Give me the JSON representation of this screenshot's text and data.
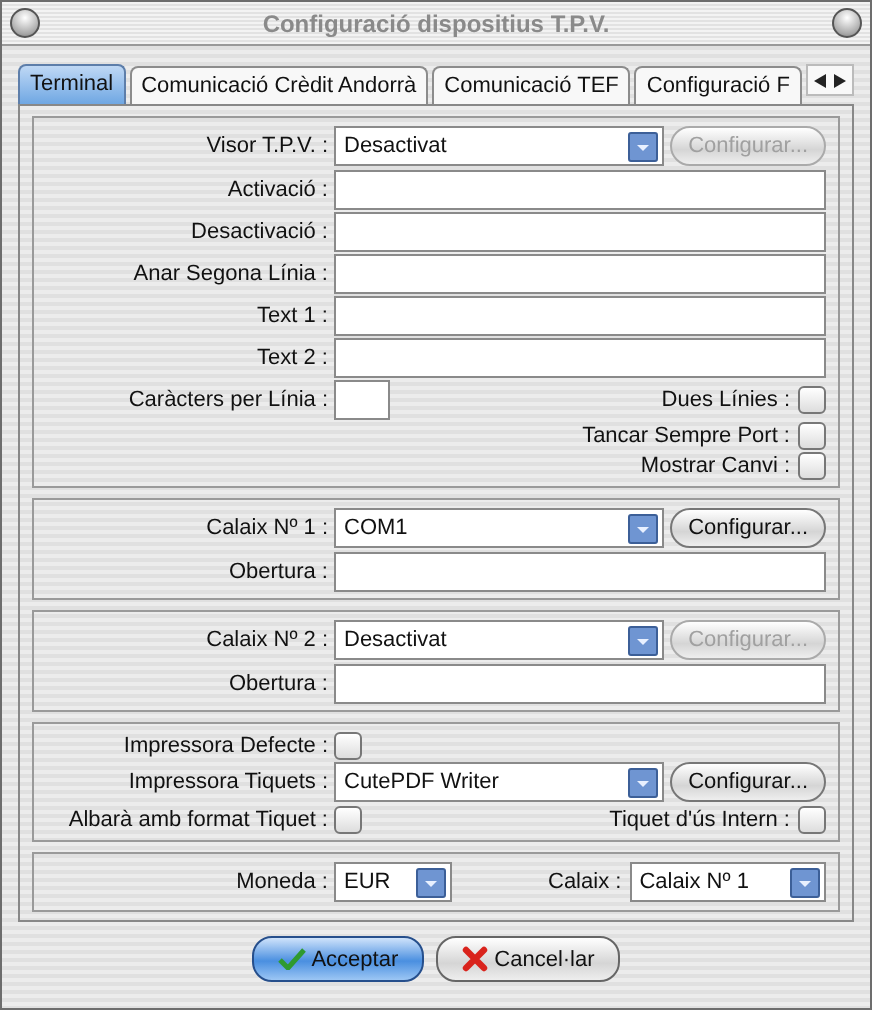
{
  "window": {
    "title": "Configuració dispositius T.P.V."
  },
  "tabs": [
    {
      "label": "Terminal",
      "selected": true
    },
    {
      "label": "Comunicació Crèdit Andorrà",
      "selected": false
    },
    {
      "label": "Comunicació TEF",
      "selected": false
    },
    {
      "label": "Configuració F",
      "selected": false
    }
  ],
  "sections": [
    {
      "rows": [
        {
          "kind": "combo",
          "label": "Visor T.P.V. :",
          "value": "Desactivat",
          "button": {
            "label": "Configurar...",
            "disabled": true
          }
        },
        {
          "kind": "text",
          "label": "Activació :"
        },
        {
          "kind": "text",
          "label": "Desactivació :"
        },
        {
          "kind": "text",
          "label": "Anar Segona Línia :"
        },
        {
          "kind": "text",
          "label": "Text 1 :"
        },
        {
          "kind": "text",
          "label": "Text 2 :"
        },
        {
          "kind": "short",
          "label": "Caràcters per Línia :",
          "right_label": "Dues Línies :",
          "right_checked": false
        },
        {
          "kind": "check_right",
          "right_label": "Tancar Sempre Port :",
          "right_checked": false
        },
        {
          "kind": "check_right",
          "right_label": "Mostrar Canvi :",
          "right_checked": false
        }
      ]
    },
    {
      "rows": [
        {
          "kind": "combo",
          "label": "Calaix Nº 1 :",
          "value": "COM1",
          "button": {
            "label": "Configurar...",
            "disabled": false
          }
        },
        {
          "kind": "text",
          "label": "Obertura :"
        }
      ]
    },
    {
      "rows": [
        {
          "kind": "combo",
          "label": "Calaix Nº 2 :",
          "value": "Desactivat",
          "button": {
            "label": "Configurar...",
            "disabled": true
          }
        },
        {
          "kind": "text",
          "label": "Obertura :"
        }
      ]
    },
    {
      "rows": [
        {
          "kind": "check",
          "label": "Impressora Defecte :",
          "checked": false
        },
        {
          "kind": "combo",
          "label": "Impressora Tiquets :",
          "value": "CutePDF Writer",
          "button": {
            "label": "Configurar...",
            "disabled": false
          }
        },
        {
          "kind": "check_pair",
          "label": "Albarà amb format Tiquet :",
          "checked": false,
          "right_label": "Tiquet d'ús Intern :",
          "right_checked": false
        }
      ]
    },
    {
      "rows": [
        {
          "kind": "combo_pair",
          "label": "Moneda :",
          "value": "EUR",
          "right_label": "Calaix :",
          "right_value": "Calaix Nº 1"
        }
      ]
    }
  ],
  "buttons": [
    {
      "label": "Acceptar",
      "kind": "ok",
      "default": true
    },
    {
      "label": "Cancel·lar",
      "kind": "cancel",
      "default": false
    }
  ]
}
